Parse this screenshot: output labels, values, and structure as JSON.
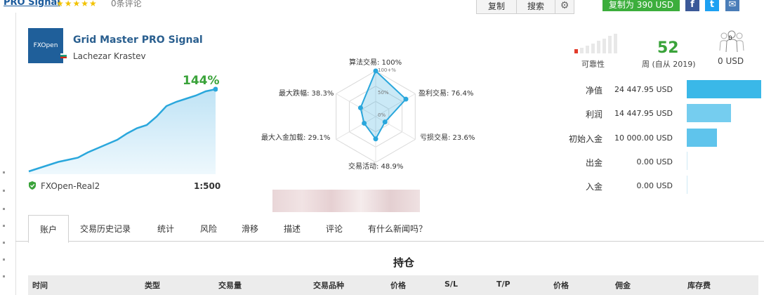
{
  "header": {
    "title": "PRO Signal",
    "stars": "★★★★★",
    "reviews": "0条评论",
    "copy_label": "复制",
    "search_label": "搜索",
    "settings_icon": "gear-icon",
    "copy_price_label": "复制为 390 USD",
    "social": [
      {
        "name": "facebook-icon",
        "glyph": "f",
        "color": "#3b5998"
      },
      {
        "name": "twitter-icon",
        "glyph": "t",
        "color": "#1da1f2"
      },
      {
        "name": "chat-icon",
        "glyph": "✉",
        "color": "#4a7db8"
      }
    ]
  },
  "signal": {
    "logo_text": "FXOpen",
    "title": "Grid Master PRO Signal",
    "author": "Lachezar Krastev",
    "growth": "144%",
    "broker": "FXOpen-Real2",
    "leverage": "1:500"
  },
  "growth_chart": {
    "type": "area",
    "values": [
      0,
      3,
      6,
      9,
      11,
      13,
      18,
      22,
      26,
      30,
      36,
      41,
      44,
      52,
      62,
      66,
      69,
      72,
      76,
      78
    ]
  },
  "radar": {
    "center_labels": {
      "outer": "100+%",
      "mid": "50%",
      "inner": "0%"
    },
    "labels": {
      "top": "算法交易: 100%",
      "top_right": "盈利交易: 76.4%",
      "bottom_right": "亏损交易: 23.6%",
      "bottom": "交易活动: 48.9%",
      "bottom_left": "最大入金加载: 29.1%",
      "top_left": "最大跌幅: 38.3%"
    }
  },
  "chart_data": {
    "type": "radar",
    "categories": [
      "算法交易",
      "盈利交易",
      "亏损交易",
      "交易活动",
      "最大入金加载",
      "最大跌幅"
    ],
    "values": [
      100,
      76.4,
      23.6,
      48.9,
      29.1,
      38.3
    ]
  },
  "stats": {
    "reliability_label": "可靠性",
    "weeks_value": "52",
    "weeks_label": "周 (自从 2019)",
    "subscribers_value": "0",
    "subscribers_label": "0 USD"
  },
  "finance": [
    {
      "label": "净值",
      "value": "24 447.95 USD",
      "amount": 24447.95
    },
    {
      "label": "利润",
      "value": "14 447.95 USD",
      "amount": 14447.95
    },
    {
      "label": "初始入金",
      "value": "10 000.00 USD",
      "amount": 10000.0
    },
    {
      "label": "出金",
      "value": "0.00 USD",
      "amount": 0
    },
    {
      "label": "入金",
      "value": "0.00 USD",
      "amount": 0
    }
  ],
  "tabs": [
    "账户",
    "交易历史记录",
    "统计",
    "风险",
    "滑移",
    "描述",
    "评论",
    "有什么新闻吗？"
  ],
  "positions": {
    "title": "持仓",
    "columns": [
      "时间",
      "类型",
      "交易量",
      "交易品种",
      "价格",
      "S/L",
      "T/P",
      "价格",
      "佣金",
      "库存费"
    ]
  }
}
